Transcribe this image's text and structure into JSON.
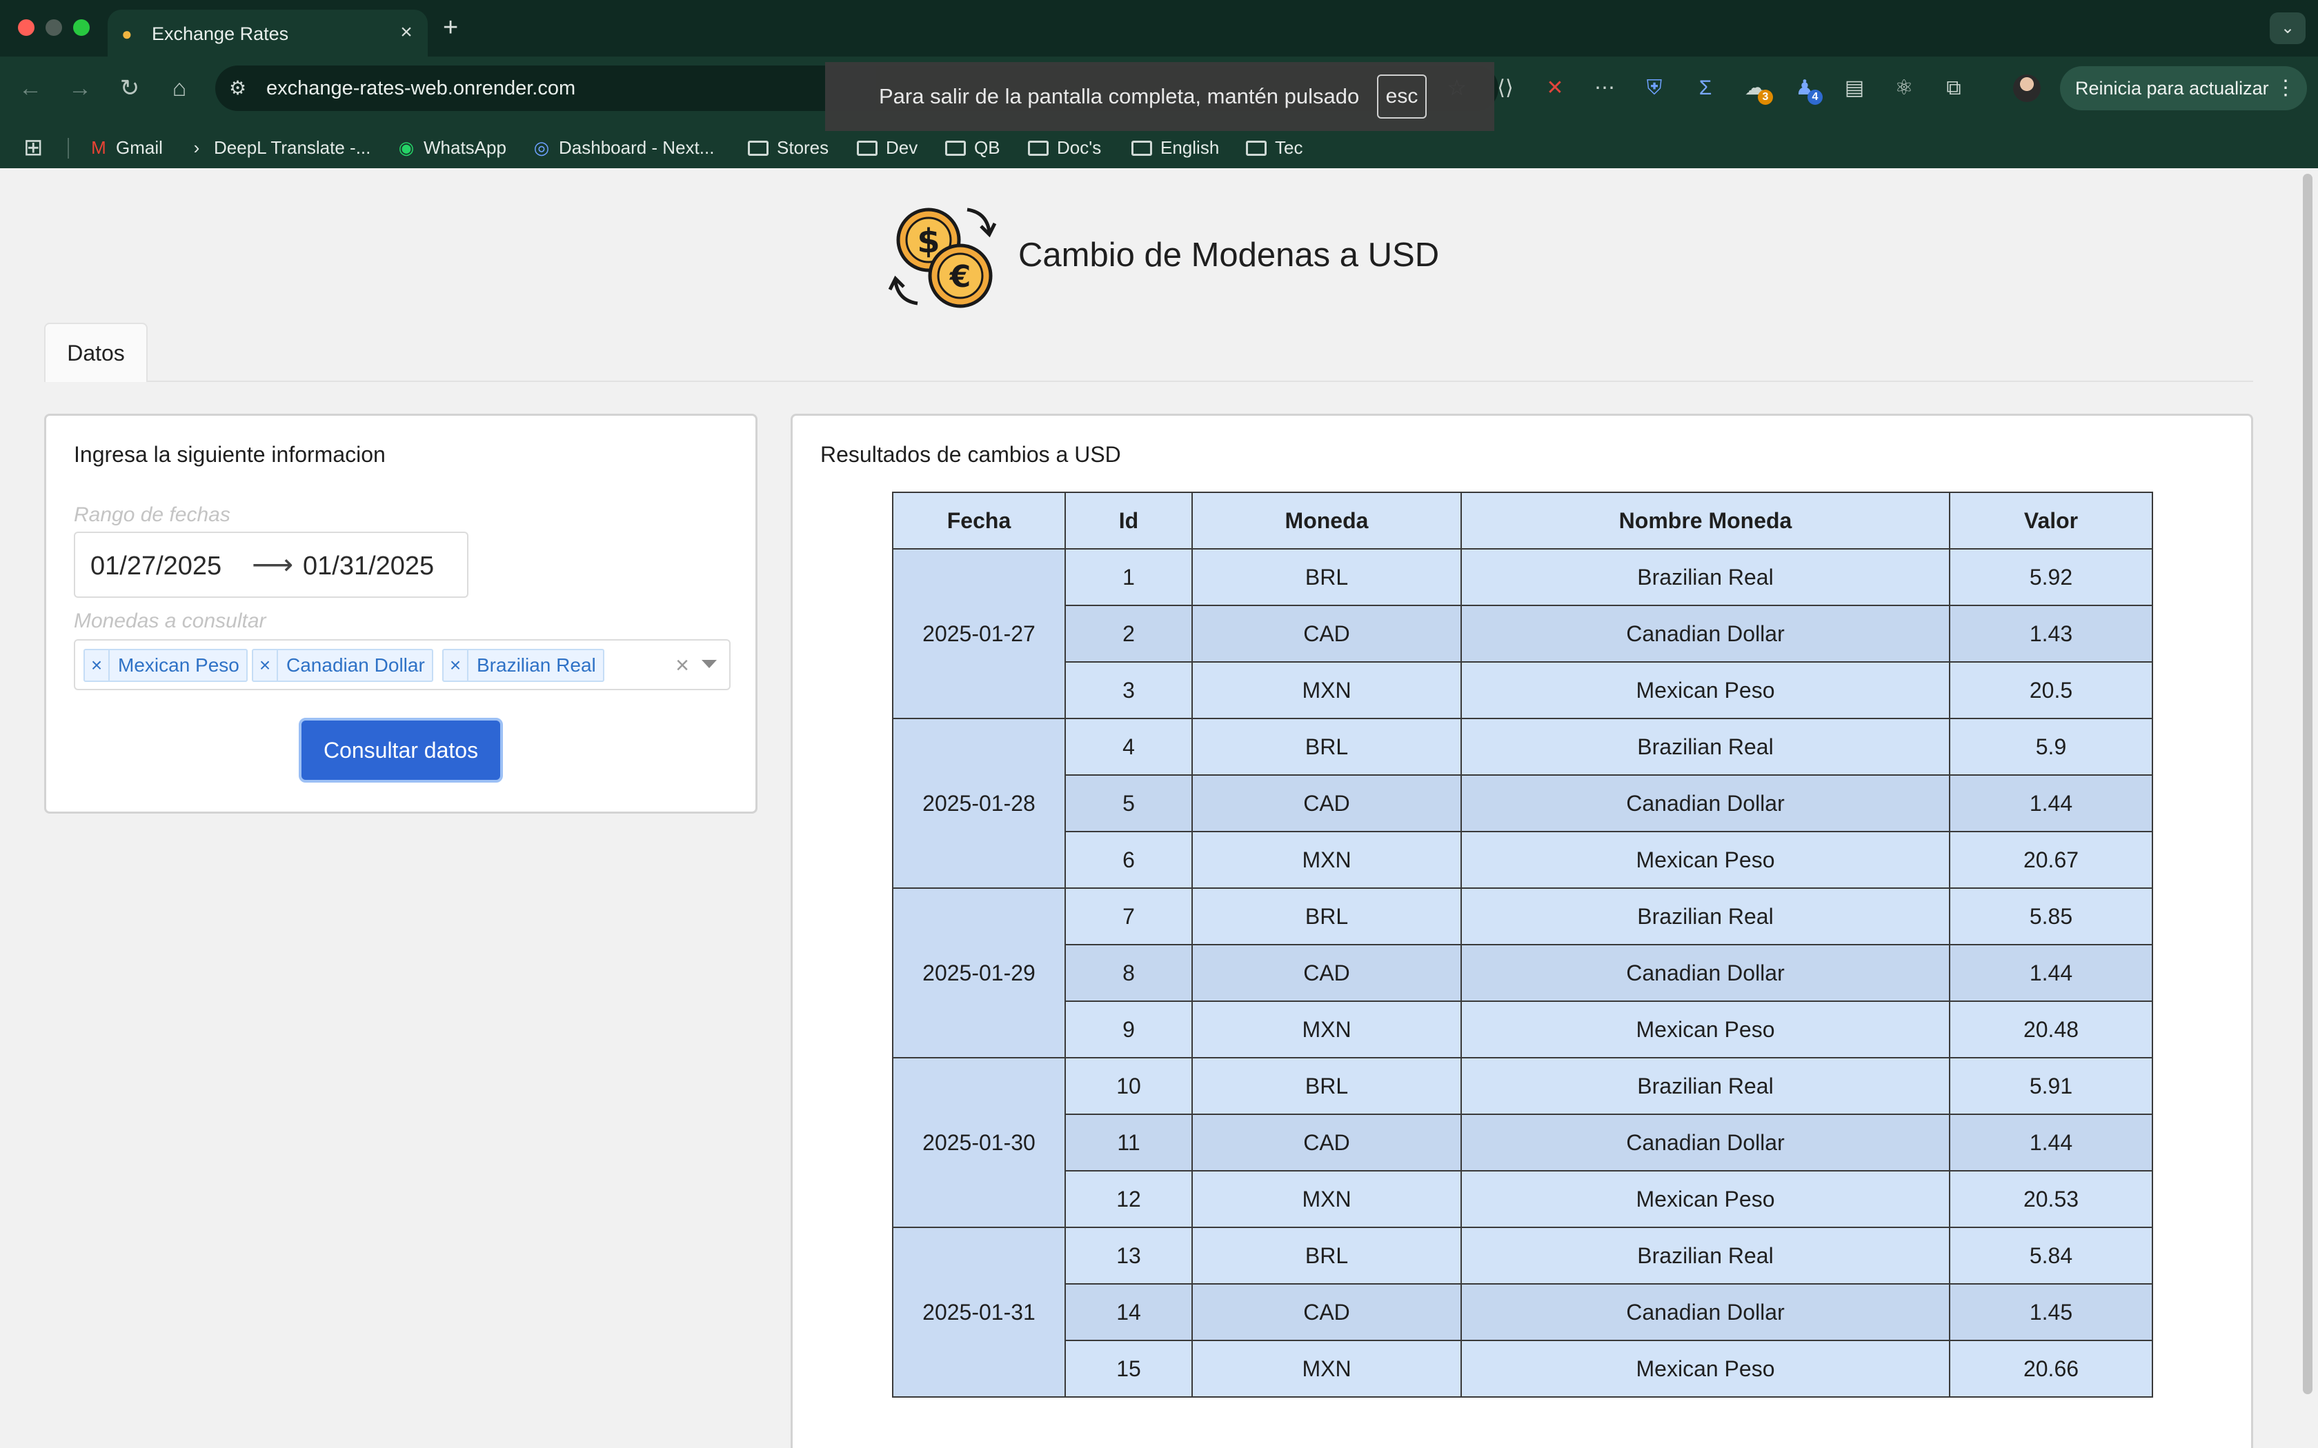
{
  "browser": {
    "tab_title": "Exchange Rates",
    "url": "exchange-rates-web.onrender.com",
    "fullscreen_toast": "Para salir de la pantalla completa, mantén pulsado",
    "fullscreen_key": "esc",
    "update_button": "Reinicia para actualizar",
    "extension_badges": [
      "3",
      "4"
    ],
    "bookmarks": [
      {
        "label": "Gmail",
        "icon": "gmail-icon"
      },
      {
        "label": "DeepL Translate -...",
        "icon": "deepl-icon"
      },
      {
        "label": "WhatsApp",
        "icon": "whatsapp-icon"
      },
      {
        "label": "Dashboard - Next...",
        "icon": "dashboard-icon"
      },
      {
        "label": "Stores",
        "icon": "folder-icon"
      },
      {
        "label": "Dev",
        "icon": "folder-icon"
      },
      {
        "label": "QB",
        "icon": "folder-icon"
      },
      {
        "label": "Doc's",
        "icon": "folder-icon"
      },
      {
        "label": "English",
        "icon": "folder-icon"
      },
      {
        "label": "Tec",
        "icon": "folder-icon"
      }
    ]
  },
  "page": {
    "title": "Cambio de Modenas a USD",
    "tab_label": "Datos"
  },
  "form": {
    "title": "Ingresa la siguiente informacion",
    "date_label": "Rango de fechas",
    "date_start": "01/27/2025",
    "date_end": "01/31/2025",
    "currencies_label": "Monedas a consultar",
    "selected_currencies": [
      "Mexican Peso",
      "Canadian Dollar",
      "Brazilian Real"
    ],
    "submit_label": "Consultar datos"
  },
  "results": {
    "title": "Resultados de cambios a USD",
    "columns": [
      "Fecha",
      "Id",
      "Moneda",
      "Nombre Moneda",
      "Valor"
    ],
    "groups": [
      {
        "fecha": "2025-01-27",
        "rows": [
          {
            "id": "1",
            "moneda": "BRL",
            "nombre": "Brazilian Real",
            "valor": "5.92"
          },
          {
            "id": "2",
            "moneda": "CAD",
            "nombre": "Canadian Dollar",
            "valor": "1.43"
          },
          {
            "id": "3",
            "moneda": "MXN",
            "nombre": "Mexican Peso",
            "valor": "20.5"
          }
        ]
      },
      {
        "fecha": "2025-01-28",
        "rows": [
          {
            "id": "4",
            "moneda": "BRL",
            "nombre": "Brazilian Real",
            "valor": "5.9"
          },
          {
            "id": "5",
            "moneda": "CAD",
            "nombre": "Canadian Dollar",
            "valor": "1.44"
          },
          {
            "id": "6",
            "moneda": "MXN",
            "nombre": "Mexican Peso",
            "valor": "20.67"
          }
        ]
      },
      {
        "fecha": "2025-01-29",
        "rows": [
          {
            "id": "7",
            "moneda": "BRL",
            "nombre": "Brazilian Real",
            "valor": "5.85"
          },
          {
            "id": "8",
            "moneda": "CAD",
            "nombre": "Canadian Dollar",
            "valor": "1.44"
          },
          {
            "id": "9",
            "moneda": "MXN",
            "nombre": "Mexican Peso",
            "valor": "20.48"
          }
        ]
      },
      {
        "fecha": "2025-01-30",
        "rows": [
          {
            "id": "10",
            "moneda": "BRL",
            "nombre": "Brazilian Real",
            "valor": "5.91"
          },
          {
            "id": "11",
            "moneda": "CAD",
            "nombre": "Canadian Dollar",
            "valor": "1.44"
          },
          {
            "id": "12",
            "moneda": "MXN",
            "nombre": "Mexican Peso",
            "valor": "20.53"
          }
        ]
      },
      {
        "fecha": "2025-01-31",
        "rows": [
          {
            "id": "13",
            "moneda": "BRL",
            "nombre": "Brazilian Real",
            "valor": "5.84"
          },
          {
            "id": "14",
            "moneda": "CAD",
            "nombre": "Canadian Dollar",
            "valor": "1.45"
          },
          {
            "id": "15",
            "moneda": "MXN",
            "nombre": "Mexican Peso",
            "valor": "20.66"
          }
        ]
      }
    ]
  },
  "colors": {
    "chrome_bg": "#173a2e",
    "primary_button": "#2d66d4",
    "chip_text": "#2f72c6",
    "table_header": "#d4e4f8"
  }
}
